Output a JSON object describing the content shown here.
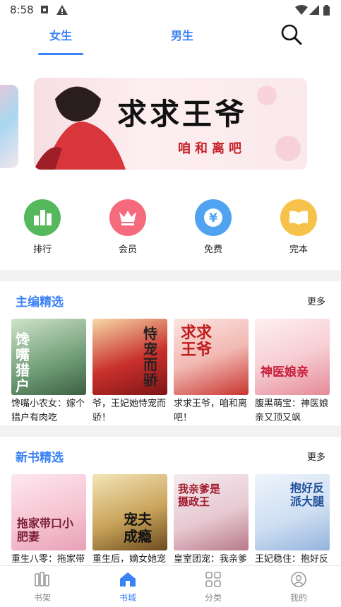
{
  "status": {
    "time": "8:58"
  },
  "tabs": [
    {
      "label": "女生"
    },
    {
      "label": "男生"
    }
  ],
  "banner": {
    "title": "求求王爷",
    "subtitle": "咱和离吧"
  },
  "quick": [
    {
      "label": "排行",
      "color": "#55b85c",
      "icon": "ranking-icon"
    },
    {
      "label": "会员",
      "color": "#f56b7d",
      "icon": "crown-icon"
    },
    {
      "label": "免费",
      "color": "#4fa3f0",
      "icon": "yen-icon"
    },
    {
      "label": "完本",
      "color": "#f7c24a",
      "icon": "book-icon"
    }
  ],
  "sections": [
    {
      "title": "主编精选",
      "more": "更多",
      "books": [
        {
          "title": "馋嘴小农女：嫁个猎户有肉吃",
          "cover_text": "馋嘴猎户"
        },
        {
          "title": "爷，王妃她恃宠而骄！",
          "cover_text": "恃宠而骄"
        },
        {
          "title": "求求王爷，咱和离吧！",
          "cover_text": "求求王爷"
        },
        {
          "title": "腹黑萌宝：神医娘亲又顶又飒",
          "cover_text": "神医娘亲"
        }
      ]
    },
    {
      "title": "新书精选",
      "more": "更多",
      "books": [
        {
          "title": "重生八零：拖家带",
          "cover_text": "拖家带口小肥妻"
        },
        {
          "title": "重生后，嫡女她宠",
          "cover_text": "宠夫成瘾"
        },
        {
          "title": "皇室团宠：我亲爹",
          "cover_text": "我亲爹是摄政王"
        },
        {
          "title": "王妃稳住：抱好反",
          "cover_text": "抱好反派大腿"
        }
      ]
    }
  ],
  "nav": [
    {
      "label": "书架",
      "icon": "bookshelf-icon",
      "active": false
    },
    {
      "label": "书城",
      "icon": "bookstore-icon",
      "active": true
    },
    {
      "label": "分类",
      "icon": "category-icon",
      "active": false
    },
    {
      "label": "我的",
      "icon": "profile-icon",
      "active": false
    }
  ]
}
